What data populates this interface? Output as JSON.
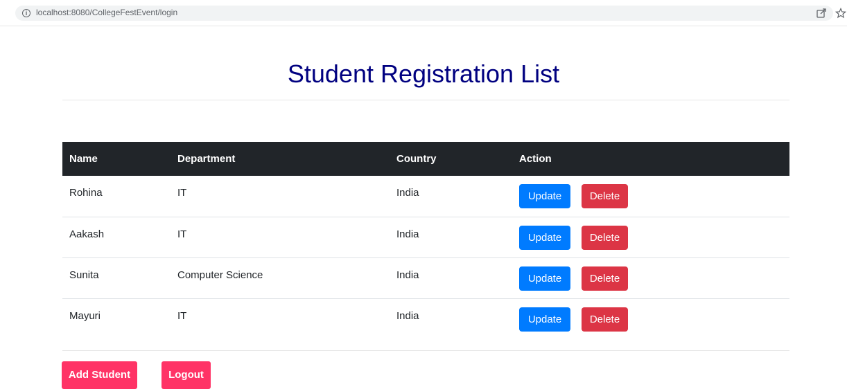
{
  "browser": {
    "url": "localhost:8080/CollegeFestEvent/login",
    "info_icon": "info-icon",
    "share_icon": "share-icon",
    "star_icon": "star-icon"
  },
  "page": {
    "title": "Student Registration List"
  },
  "table": {
    "headers": [
      "Name",
      "Department",
      "Country",
      "Action"
    ],
    "rows": [
      {
        "name": "Rohina",
        "department": "IT",
        "country": "India"
      },
      {
        "name": "Aakash",
        "department": "IT",
        "country": "India"
      },
      {
        "name": "Sunita",
        "department": "Computer Science",
        "country": "India"
      },
      {
        "name": "Mayuri",
        "department": "IT",
        "country": "India"
      }
    ],
    "update_label": "Update",
    "delete_label": "Delete"
  },
  "footer": {
    "add_label": "Add Student",
    "logout_label": "Logout"
  },
  "colors": {
    "title": "#000080",
    "header_bg": "#212529",
    "update": "#007bff",
    "delete": "#dc3545",
    "action_pink": "#ff3366"
  }
}
